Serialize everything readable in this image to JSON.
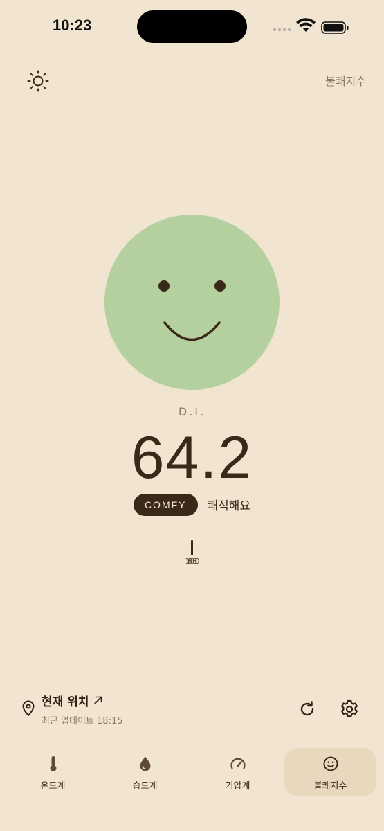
{
  "status_bar": {
    "time": "10:23"
  },
  "header": {
    "page_label": "불쾌지수"
  },
  "face": {
    "color": "#B4D09E",
    "mood": "smile"
  },
  "index": {
    "label": "D.I.",
    "value": "64.2",
    "badge": "COMFY",
    "description": "쾌적해요"
  },
  "gauge": {
    "labels": [
      "100",
      "68",
      "80"
    ]
  },
  "location": {
    "title": "현재 위치",
    "updated": "최근 업데이트 18:15"
  },
  "tabs": [
    {
      "label": "온도계",
      "icon": "thermometer-icon"
    },
    {
      "label": "습도계",
      "icon": "droplet-icon"
    },
    {
      "label": "기압계",
      "icon": "gauge-icon"
    },
    {
      "label": "불쾌지수",
      "icon": "smiley-icon",
      "active": true
    }
  ],
  "colors": {
    "background": "#F1E5D2",
    "text": "#3A2818",
    "accent_face": "#B4D09E",
    "active_tab": "#E8D9BE"
  }
}
